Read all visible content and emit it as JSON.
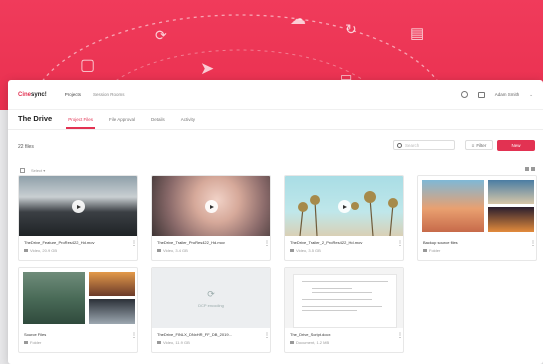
{
  "header": {
    "logo_part1": "Cine",
    "logo_part2": "sync!",
    "nav": [
      "Projects",
      "Session Rooms"
    ],
    "user_name": "Adam Smith"
  },
  "project": {
    "title": "The Drive",
    "tabs": [
      "Project Files",
      "File Approval",
      "Details",
      "Activity"
    ],
    "active_tab": 0
  },
  "toolbar": {
    "file_count": "22 files",
    "search_placeholder": "Search",
    "filter_label": "Filter",
    "new_label": "New"
  },
  "select_all": "Select ▾",
  "colors": {
    "accent": "#e23252",
    "hero": "#ef3a5a"
  },
  "files": [
    {
      "name": "TheDrive_Feature_ProRes422_Hd.mov",
      "type": "Video, 20.9 GB",
      "kind": "video"
    },
    {
      "name": "TheDrive_Trailer_ProRes422_Hd.mov",
      "type": "Video, 3.4 GB",
      "kind": "video"
    },
    {
      "name": "TheDrive_Trailer_2_ProRes422_Hd.mov",
      "type": "Video, 3.5 GB",
      "kind": "video"
    },
    {
      "name": "Backup source files",
      "type": "Folder",
      "kind": "folder"
    },
    {
      "name": "Source Files",
      "type": "Folder",
      "kind": "folder"
    },
    {
      "name": "TheDrive_FINLX_DNxHR_FF_DB_2019...",
      "type": "Video, 11.9 GB",
      "kind": "wip",
      "wip_label": "DCP encoding"
    },
    {
      "name": "The_Drive_Script.docx",
      "type": "Document, 1.2 MB",
      "kind": "doc"
    }
  ]
}
